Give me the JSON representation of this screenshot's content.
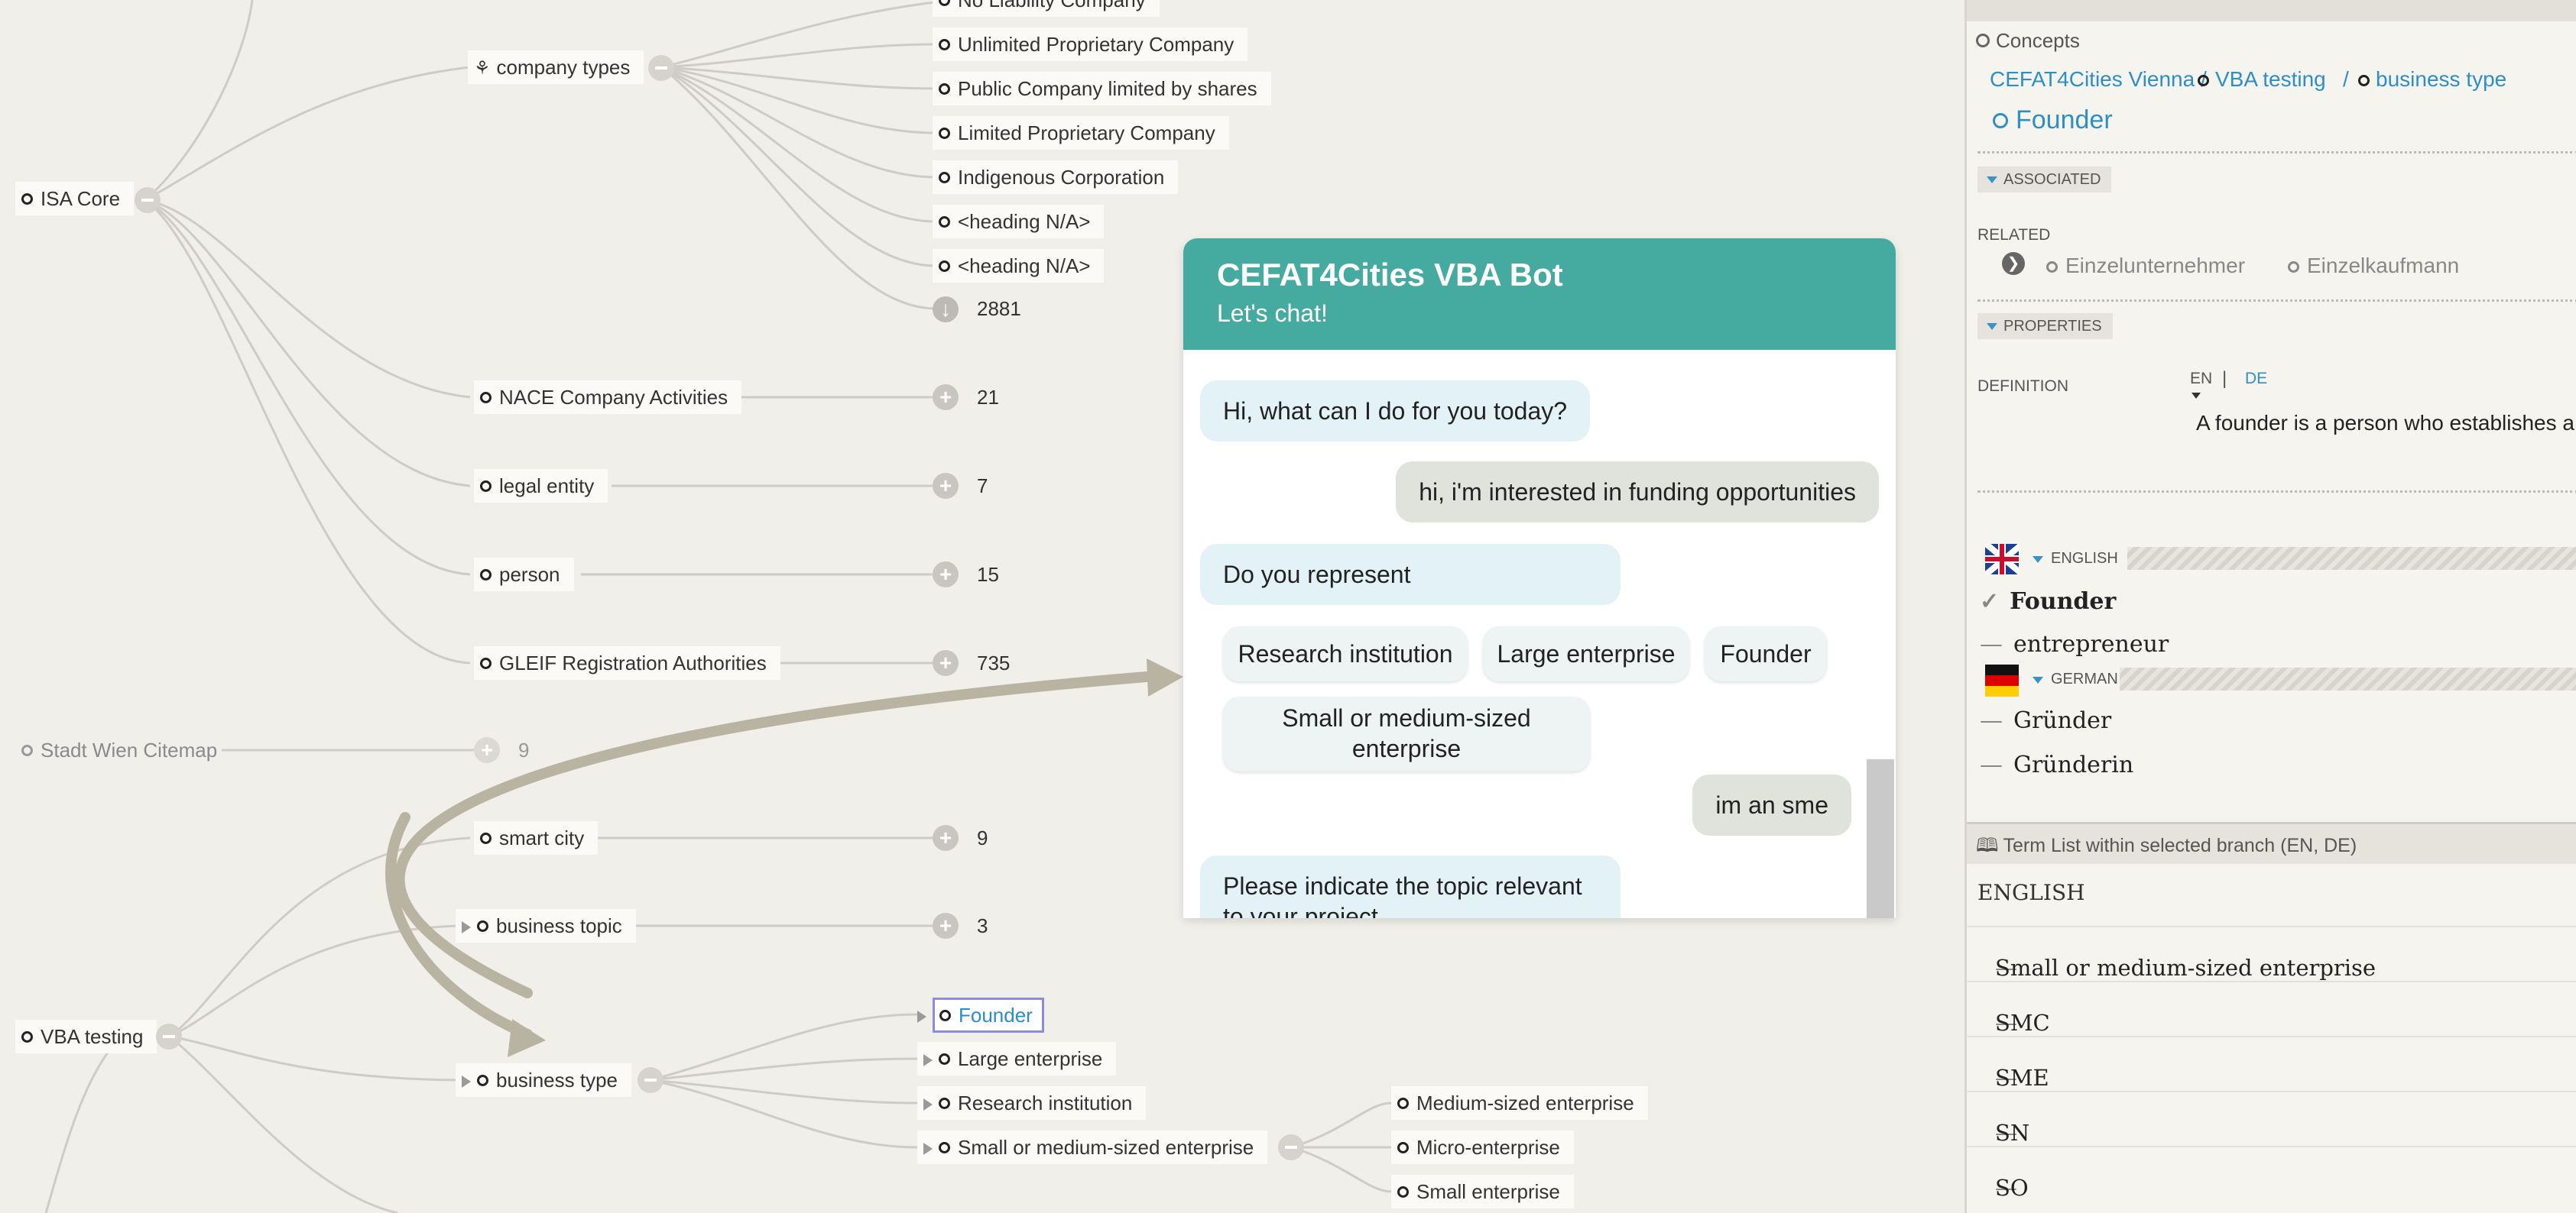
{
  "tree": {
    "top_partial": "No Liability Company",
    "isa_core": "ISA Core",
    "company_types": "company types",
    "company_type_items": [
      "Unlimited Proprietary Company",
      "Public Company limited by shares",
      "Limited Proprietary Company",
      "Indigenous Corporation",
      "<heading N/A>",
      "<heading N/A>"
    ],
    "more_count": "2881",
    "nace": {
      "label": "NACE Company Activities",
      "count": "21"
    },
    "legal_entity": {
      "label": "legal entity",
      "count": "7"
    },
    "person": {
      "label": "person",
      "count": "15"
    },
    "gleif": {
      "label": "GLEIF Registration Authorities",
      "count": "735"
    },
    "stadt_wien": {
      "label": "Stadt Wien Citemap",
      "count": "9"
    },
    "smart_city": {
      "label": "smart city",
      "count": "9"
    },
    "business_topic": {
      "label": "business topic",
      "count": "3"
    },
    "vba_testing": "VBA testing",
    "business_type": "business type",
    "business_type_items": [
      "Founder",
      "Large enterprise",
      "Research institution",
      "Small or medium-sized enterprise"
    ],
    "sme_children": [
      "Medium-sized enterprise",
      "Micro-enterprise",
      "Small enterprise"
    ]
  },
  "chat": {
    "title": "CEFAT4Cities VBA Bot",
    "subtitle": "Let's chat!",
    "msg1": "Hi, what can I do for you today?",
    "msg2": "hi, i'm interested in funding opportunities",
    "msg3": "Do you represent",
    "options": [
      "Research institution",
      "Large enterprise",
      "Founder",
      "Small or medium-sized enterprise"
    ],
    "msg4": "im an sme",
    "msg5": "Please indicate the topic relevant to your project"
  },
  "panel": {
    "concepts_title": "Concepts",
    "breadcrumb": [
      "CEFAT4Cities Vienna /",
      "VBA testing",
      "/",
      "business type"
    ],
    "concept": "Founder",
    "associated": "ASSOCIATED",
    "related_label": "RELATED",
    "related": [
      "Einzelunternehmer",
      "Einzelkaufmann"
    ],
    "properties": "PROPERTIES",
    "definition_label": "DEFINITION",
    "lang_en": "EN",
    "lang_sep": "|",
    "lang_de": "DE",
    "definition_text": "A founder is a person who establishes a",
    "english_label": "ENGLISH",
    "english_terms": [
      "Founder",
      "entrepreneur"
    ],
    "german_label": "GERMAN",
    "german_terms": [
      "Gründer",
      "Gründerin"
    ],
    "term_list_title": "Term List within selected branch (EN, DE)",
    "term_list_lang": "ENGLISH",
    "term_list": [
      "Small or medium-sized enterprise",
      "SMC",
      "SME",
      "SN",
      "SO"
    ]
  },
  "colors": {
    "chat_header": "#45aaa0",
    "link": "#2e8fc6",
    "annotation": "#b9b3a2"
  }
}
